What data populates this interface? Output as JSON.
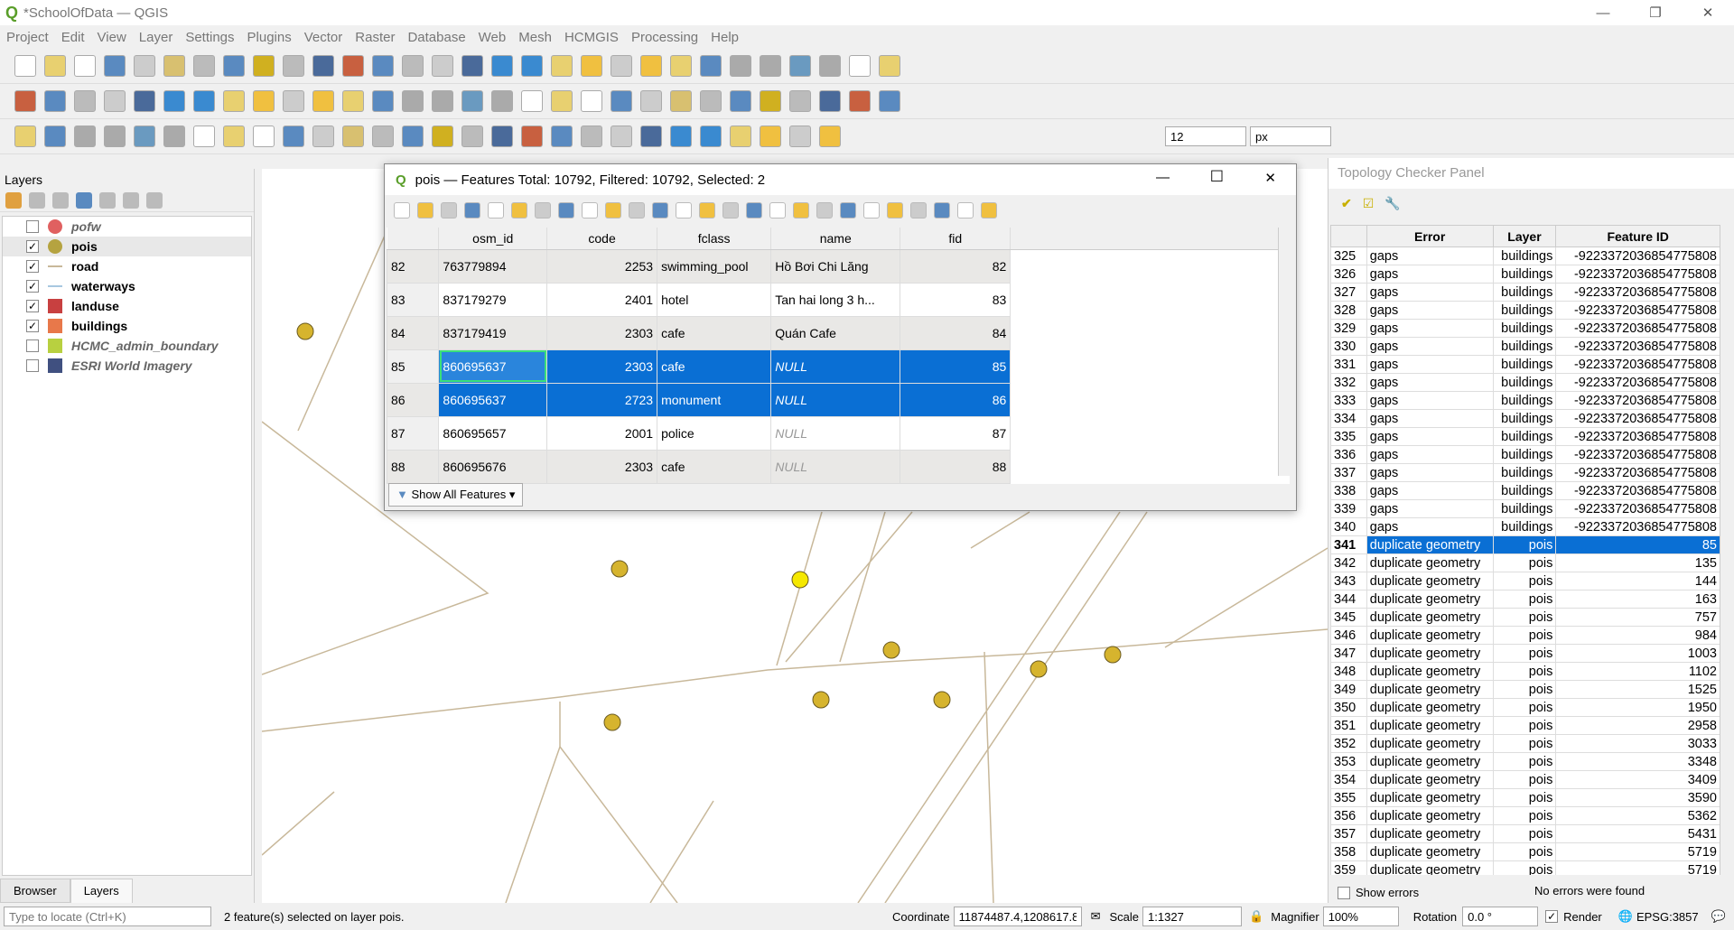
{
  "window": {
    "title": "*SchoolOfData — QGIS",
    "minimize": "—",
    "restore": "❐",
    "close": "✕"
  },
  "menu": [
    "Project",
    "Edit",
    "View",
    "Layer",
    "Settings",
    "Plugins",
    "Vector",
    "Raster",
    "Database",
    "Web",
    "Mesh",
    "HCMGIS",
    "Processing",
    "Help"
  ],
  "toolbar": {
    "snap_tolerance": "12",
    "snap_units": "px"
  },
  "layers_panel": {
    "title": "Layers",
    "items": [
      {
        "name": "pofw",
        "checked": false,
        "italic": true,
        "symbol": "#e06060"
      },
      {
        "name": "pois",
        "checked": true,
        "italic": false,
        "symbol": "#b5a340"
      },
      {
        "name": "road",
        "checked": true,
        "italic": false,
        "symbol": "#c8b89a"
      },
      {
        "name": "waterways",
        "checked": true,
        "italic": false,
        "symbol": "#a8c8e0"
      },
      {
        "name": "landuse",
        "checked": true,
        "italic": false,
        "symbol": "#c84040"
      },
      {
        "name": "buildings",
        "checked": true,
        "italic": false,
        "symbol": "#e8784a"
      },
      {
        "name": "HCMC_admin_boundary",
        "checked": false,
        "italic": true,
        "symbol": "#b8d040"
      },
      {
        "name": "ESRI World Imagery",
        "checked": false,
        "italic": true,
        "symbol": "#405080"
      }
    ],
    "tabs": [
      "Browser",
      "Layers"
    ]
  },
  "attribute_table": {
    "title": "pois — Features Total: 10792, Filtered: 10792, Selected: 2",
    "columns": [
      "osm_id",
      "code",
      "fclass",
      "name",
      "fid"
    ],
    "rows": [
      {
        "n": "82",
        "osm_id": "763779894",
        "code": "2253",
        "fclass": "swimming_pool",
        "name": "Hồ Bơi Chi Lăng",
        "fid": "82",
        "selected": false
      },
      {
        "n": "83",
        "osm_id": "837179279",
        "code": "2401",
        "fclass": "hotel",
        "name": "Tan hai long 3 h...",
        "fid": "83",
        "selected": false
      },
      {
        "n": "84",
        "osm_id": "837179419",
        "code": "2303",
        "fclass": "cafe",
        "name": "Quán Cafe",
        "fid": "84",
        "selected": false
      },
      {
        "n": "85",
        "osm_id": "860695637",
        "code": "2303",
        "fclass": "cafe",
        "name": "NULL",
        "fid": "85",
        "selected": true
      },
      {
        "n": "86",
        "osm_id": "860695637",
        "code": "2723",
        "fclass": "monument",
        "name": "NULL",
        "fid": "86",
        "selected": true
      },
      {
        "n": "87",
        "osm_id": "860695657",
        "code": "2001",
        "fclass": "police",
        "name": "NULL",
        "fid": "87",
        "selected": false
      },
      {
        "n": "88",
        "osm_id": "860695676",
        "code": "2303",
        "fclass": "cafe",
        "name": "NULL",
        "fid": "88",
        "selected": false
      }
    ],
    "show_all": "Show All Features"
  },
  "topology": {
    "title": "Topology Checker Panel",
    "columns": [
      "",
      "Error",
      "Layer",
      "Feature ID"
    ],
    "rows": [
      [
        "325",
        "gaps",
        "buildings",
        "-9223372036854775808"
      ],
      [
        "326",
        "gaps",
        "buildings",
        "-9223372036854775808"
      ],
      [
        "327",
        "gaps",
        "buildings",
        "-9223372036854775808"
      ],
      [
        "328",
        "gaps",
        "buildings",
        "-9223372036854775808"
      ],
      [
        "329",
        "gaps",
        "buildings",
        "-9223372036854775808"
      ],
      [
        "330",
        "gaps",
        "buildings",
        "-9223372036854775808"
      ],
      [
        "331",
        "gaps",
        "buildings",
        "-9223372036854775808"
      ],
      [
        "332",
        "gaps",
        "buildings",
        "-9223372036854775808"
      ],
      [
        "333",
        "gaps",
        "buildings",
        "-9223372036854775808"
      ],
      [
        "334",
        "gaps",
        "buildings",
        "-9223372036854775808"
      ],
      [
        "335",
        "gaps",
        "buildings",
        "-9223372036854775808"
      ],
      [
        "336",
        "gaps",
        "buildings",
        "-9223372036854775808"
      ],
      [
        "337",
        "gaps",
        "buildings",
        "-9223372036854775808"
      ],
      [
        "338",
        "gaps",
        "buildings",
        "-9223372036854775808"
      ],
      [
        "339",
        "gaps",
        "buildings",
        "-9223372036854775808"
      ],
      [
        "340",
        "gaps",
        "buildings",
        "-9223372036854775808"
      ],
      [
        "341",
        "duplicate geometry",
        "pois",
        "85"
      ],
      [
        "342",
        "duplicate geometry",
        "pois",
        "135"
      ],
      [
        "343",
        "duplicate geometry",
        "pois",
        "144"
      ],
      [
        "344",
        "duplicate geometry",
        "pois",
        "163"
      ],
      [
        "345",
        "duplicate geometry",
        "pois",
        "757"
      ],
      [
        "346",
        "duplicate geometry",
        "pois",
        "984"
      ],
      [
        "347",
        "duplicate geometry",
        "pois",
        "1003"
      ],
      [
        "348",
        "duplicate geometry",
        "pois",
        "1102"
      ],
      [
        "349",
        "duplicate geometry",
        "pois",
        "1525"
      ],
      [
        "350",
        "duplicate geometry",
        "pois",
        "1950"
      ],
      [
        "351",
        "duplicate geometry",
        "pois",
        "2958"
      ],
      [
        "352",
        "duplicate geometry",
        "pois",
        "3033"
      ],
      [
        "353",
        "duplicate geometry",
        "pois",
        "3348"
      ],
      [
        "354",
        "duplicate geometry",
        "pois",
        "3409"
      ],
      [
        "355",
        "duplicate geometry",
        "pois",
        "3590"
      ],
      [
        "356",
        "duplicate geometry",
        "pois",
        "5362"
      ],
      [
        "357",
        "duplicate geometry",
        "pois",
        "5431"
      ],
      [
        "358",
        "duplicate geometry",
        "pois",
        "5719"
      ],
      [
        "359",
        "duplicate geometry",
        "pois",
        "5719"
      ]
    ],
    "selected_row": "341",
    "show_errors": "Show errors",
    "status": "No errors were found"
  },
  "statusbar": {
    "locate_placeholder": "Type to locate (Ctrl+K)",
    "message": "2 feature(s) selected on layer pois.",
    "coordinate_label": "Coordinate",
    "coordinate": "11874487.4,1208617.8",
    "scale_label": "Scale",
    "scale": "1:1327",
    "magnifier_label": "Magnifier",
    "magnifier": "100%",
    "rotation_label": "Rotation",
    "rotation": "0.0 °",
    "render_label": "Render",
    "crs": "EPSG:3857"
  }
}
